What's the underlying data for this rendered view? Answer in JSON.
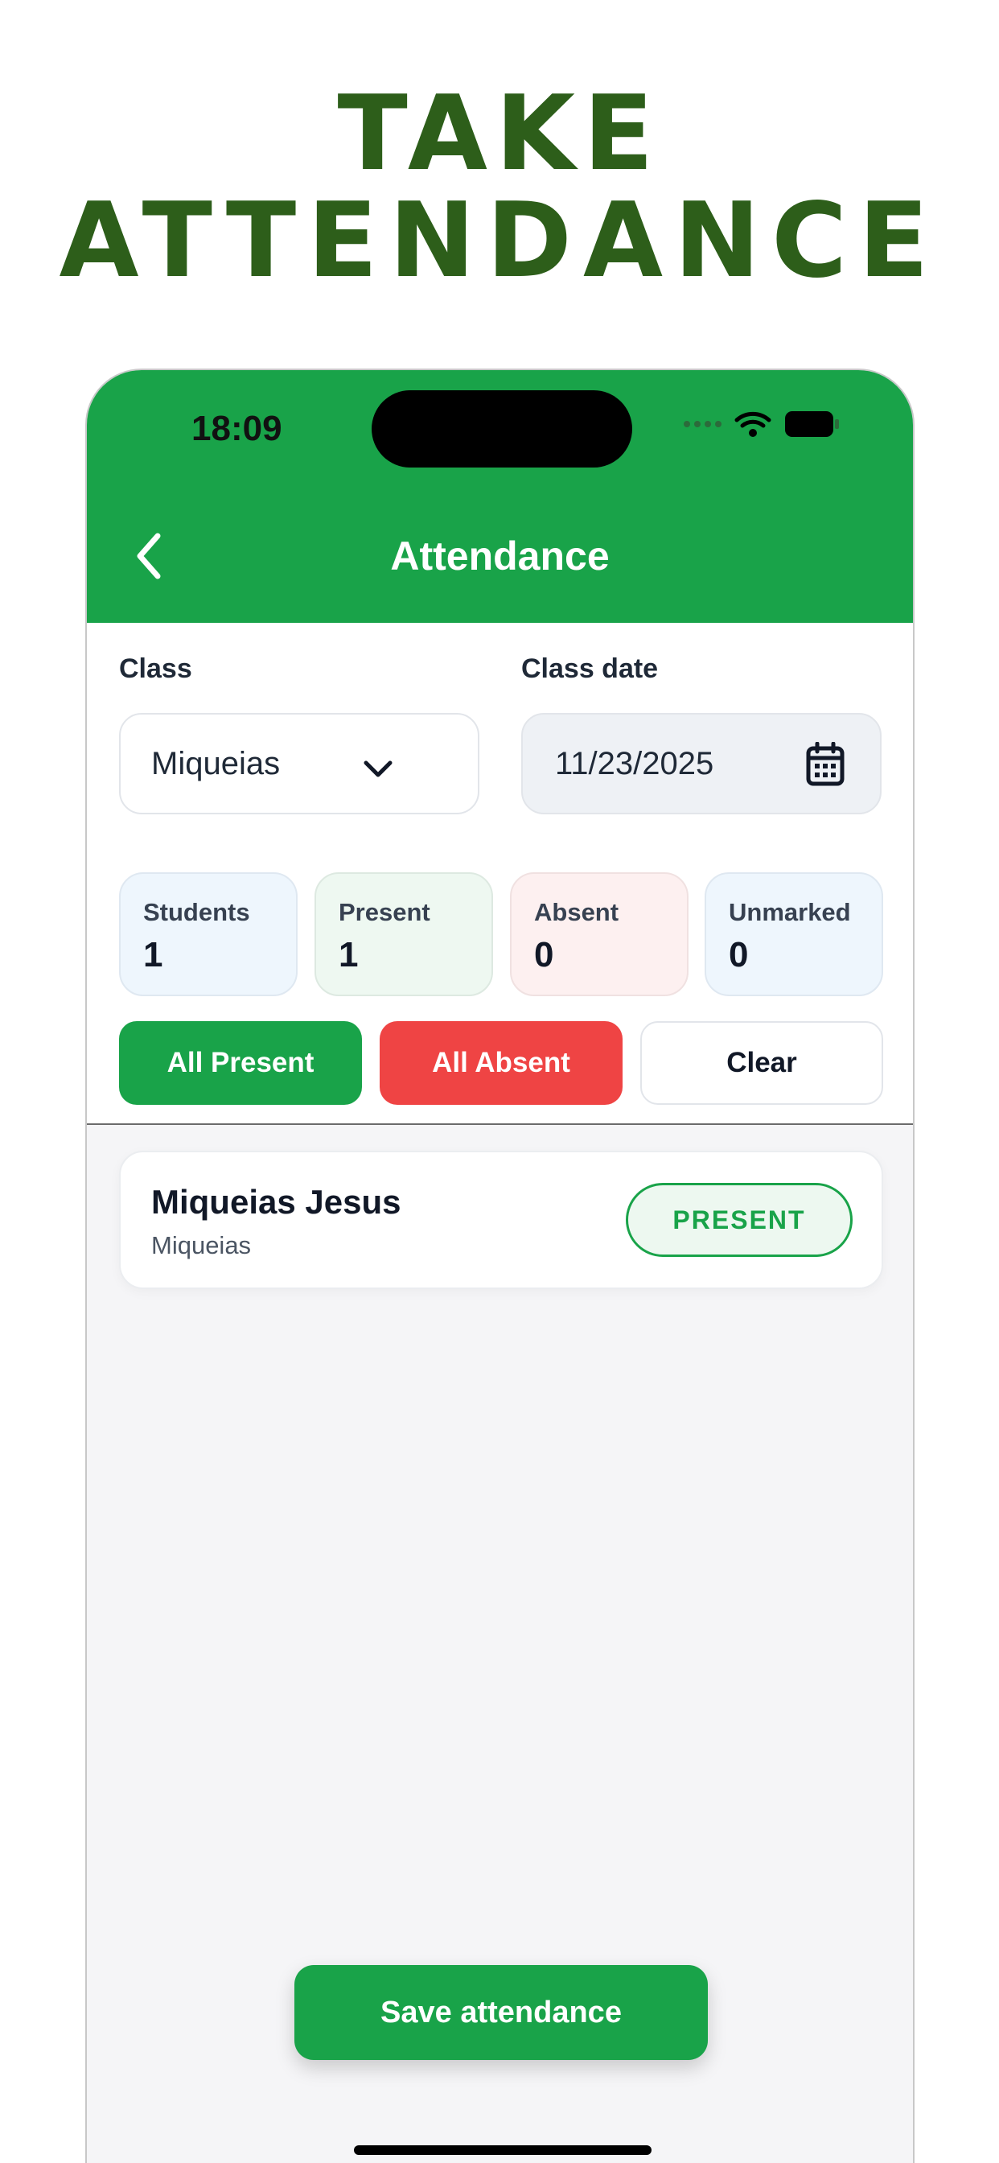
{
  "promo": {
    "line1": "TAKE",
    "line2": "ATTENDANCE"
  },
  "status_bar": {
    "time": "18:09"
  },
  "header": {
    "title": "Attendance"
  },
  "filters": {
    "class_label": "Class",
    "class_value": "Miqueias",
    "date_label": "Class date",
    "date_value": "11/23/2025"
  },
  "stats": [
    {
      "label": "Students",
      "value": "1"
    },
    {
      "label": "Present",
      "value": "1"
    },
    {
      "label": "Absent",
      "value": "0"
    },
    {
      "label": "Unmarked",
      "value": "0"
    }
  ],
  "actions": {
    "all_present": "All Present",
    "all_absent": "All Absent",
    "clear": "Clear"
  },
  "students": [
    {
      "name": "Miqueias Jesus",
      "class": "Miqueias",
      "status": "PRESENT"
    }
  ],
  "footer": {
    "save_label": "Save attendance"
  },
  "colors": {
    "brand_green": "#19a349",
    "headline_green": "#2d5e1a",
    "absent_red": "#ef4444"
  }
}
